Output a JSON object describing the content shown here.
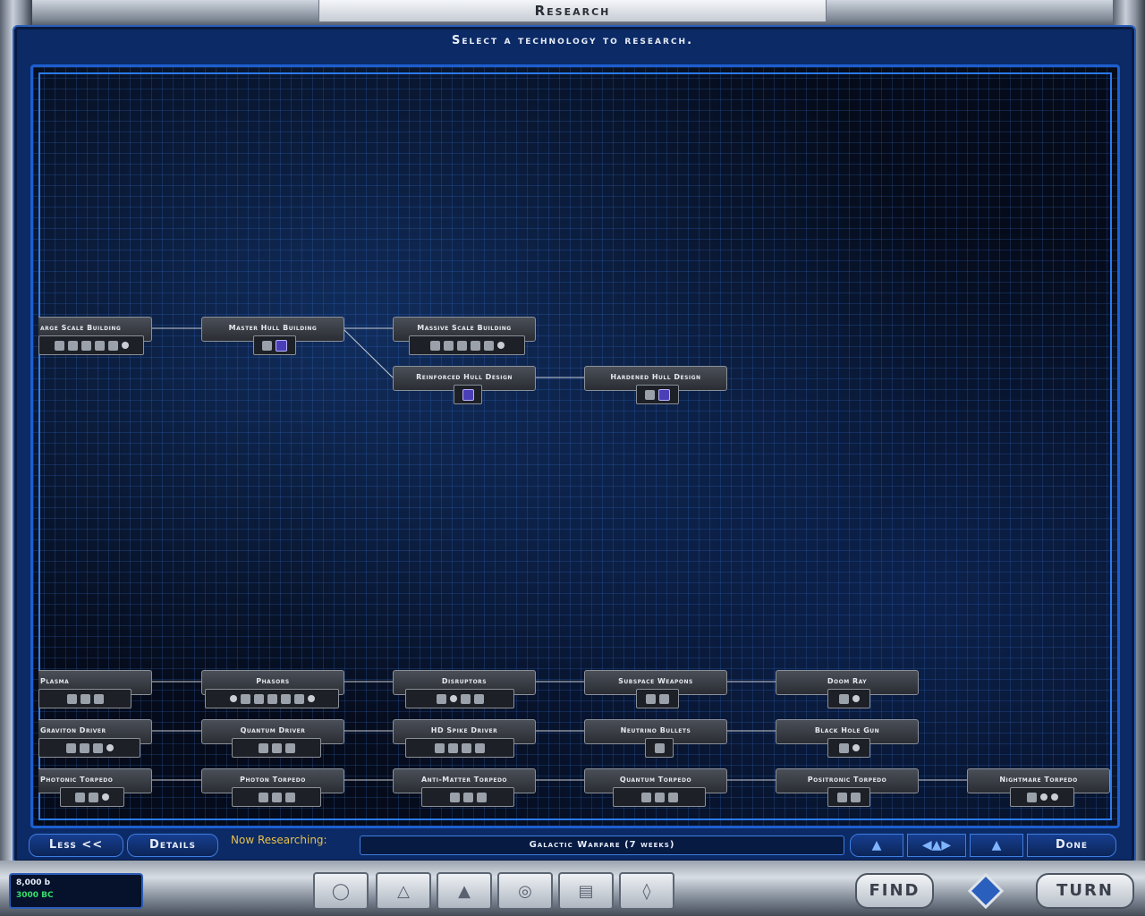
{
  "window": {
    "title": "Research"
  },
  "header": {
    "subtitle": "Select a technology to research."
  },
  "tech_rows": {
    "hull": [
      {
        "label": "arge Scale Building"
      },
      {
        "label": "Master Hull Building"
      },
      {
        "label": "Massive Scale Building"
      },
      {
        "label": "Reinforced Hull Design"
      },
      {
        "label": "Hardened Hull Design"
      }
    ],
    "beam": [
      {
        "label": "Plasma"
      },
      {
        "label": "Phasors"
      },
      {
        "label": "Disruptors"
      },
      {
        "label": "Subspace Weapons"
      },
      {
        "label": "Doom Ray"
      }
    ],
    "mass": [
      {
        "label": "Graviton Driver"
      },
      {
        "label": "Quantum Driver"
      },
      {
        "label": "HD Spike Driver"
      },
      {
        "label": "Neutrino Bullets"
      },
      {
        "label": "Black Hole Gun"
      }
    ],
    "torpedo": [
      {
        "label": "Photonic Torpedo"
      },
      {
        "label": "Photon Torpedo"
      },
      {
        "label": "Anti-Matter Torpedo"
      },
      {
        "label": "Quantum Torpedo"
      },
      {
        "label": "Positronic Torpedo"
      },
      {
        "label": "Nightmare Torpedo"
      }
    ]
  },
  "bottom_bar": {
    "less_label": "Less <<",
    "details_label": "Details",
    "now_researching_label": "Now Researching:",
    "current_research": "Galactic Warfare (7 weeks)",
    "done_label": "Done"
  },
  "stats": {
    "credits": "8,000 b",
    "bc": "3000 BC"
  },
  "footer": {
    "find_label": "FIND",
    "turn_label": "TURN"
  },
  "icons": [
    "shield-icon",
    "ship-part-icon",
    "gear-icon",
    "more-icon"
  ],
  "colors": {
    "accent": "#2b7bf0",
    "panel": "#0b2a66",
    "status_green": "#34e06a",
    "status_gold": "#e8c04a"
  }
}
